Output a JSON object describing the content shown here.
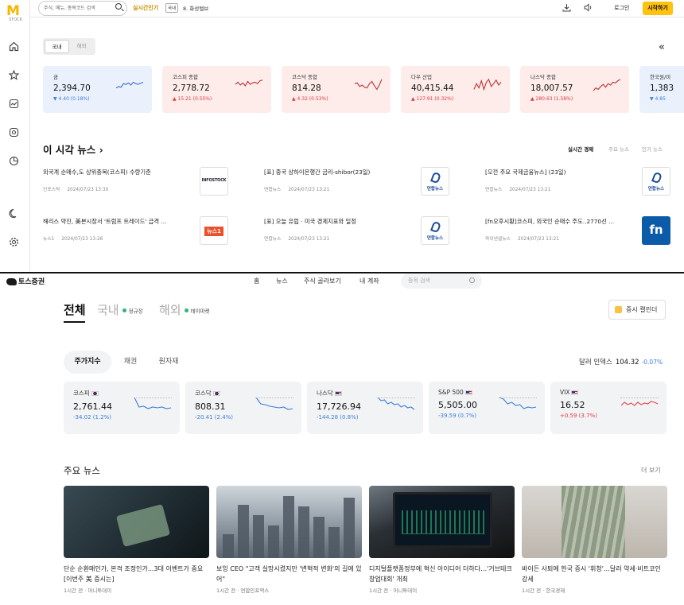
{
  "top": {
    "logo_text": "M",
    "logo_sub": "STOCK",
    "search_placeholder": "주식, 메뉴, 종목코드 검색",
    "realtime_label": "실시간인기",
    "realtime_badge": "국내",
    "realtime_item": "8. 화성밸브",
    "login": "로그인",
    "start": "시작하기",
    "market_tabs": [
      "국내",
      "해외"
    ],
    "cards": [
      {
        "name": "금",
        "value": "2,394.70",
        "change": "▼ 4.40 (0.18%)",
        "dir": "down"
      },
      {
        "name": "코스피 종합",
        "value": "2,778.72",
        "change": "▲ 15.21 (0.55%)",
        "dir": "up"
      },
      {
        "name": "코스닥 종합",
        "value": "814.28",
        "change": "▲ 4.32 (0.53%)",
        "dir": "up"
      },
      {
        "name": "다우 산업",
        "value": "40,415.44",
        "change": "▲ 127.91 (0.32%)",
        "dir": "up"
      },
      {
        "name": "나스닥 종합",
        "value": "18,007.57",
        "change": "▲ 280.63 (1.58%)",
        "dir": "up"
      },
      {
        "name": "한국원/미",
        "value": "1,383",
        "change": "▼ 4.85",
        "dir": "down"
      }
    ],
    "news_header": "이 시각 뉴스",
    "news_tabs": [
      "실시간 경제",
      "주요 뉴스",
      "인기 뉴스"
    ],
    "news": [
      {
        "title": "외국계 순매수,도 상위종목(코스피) 수량기준",
        "source": "인포스탁",
        "time": "2024/07/23 13:30",
        "thumb": "INFOSTOCK"
      },
      {
        "title": "[표] 중국 상하이은행간 금리-shibor(23일)",
        "source": "연합뉴스",
        "time": "2024/07/23 13:21",
        "thumb": "연합뉴스"
      },
      {
        "title": "[오전 주요 국제금융뉴스] (23일)",
        "source": "연합뉴스",
        "time": "2024/07/23 13:21",
        "thumb": "연합뉴스"
      },
      {
        "title": "해리스 약진, 美본시장서 '트럼프 트레이드' 급격 ...",
        "source": "뉴스1",
        "time": "2024/07/23 13:26",
        "thumb": "뉴스1"
      },
      {
        "title": "[표] 오늘 유럽 · 미국 경제지표와 일정",
        "source": "연합뉴스",
        "time": "2024/07/23 13:21",
        "thumb": "연합뉴스"
      },
      {
        "title": "[fn오후시황]코스피, 외국인 순매수 주도..2770선 ...",
        "source": "파이낸셜뉴스",
        "time": "2024/07/23 13:21",
        "thumb": "fn"
      }
    ]
  },
  "bot": {
    "logo": "토스증권",
    "nav": [
      "홈",
      "뉴스",
      "주식 골라보기",
      "내 계좌"
    ],
    "search_placeholder": "종목 검색",
    "main_tabs": [
      "전체",
      "국내",
      "해외"
    ],
    "market_status": [
      "정규장",
      "데이마켓"
    ],
    "calendar": "증시 캘린더",
    "filter_tabs": [
      "주가지수",
      "채권",
      "원자재"
    ],
    "dxy_label": "달러 인덱스",
    "dxy_value": "104.32",
    "dxy_change": "-0.07%",
    "cards": [
      {
        "name": "코스피",
        "flag": "kr",
        "value": "2,761.44",
        "change": "-34.02 (1.2%)",
        "dir": "down"
      },
      {
        "name": "코스닥",
        "flag": "kr",
        "value": "808.31",
        "change": "-20.41 (2.4%)",
        "dir": "down"
      },
      {
        "name": "나스닥",
        "flag": "us",
        "value": "17,726.94",
        "change": "-144.28 (0.8%)",
        "dir": "down"
      },
      {
        "name": "S&P 500",
        "flag": "us",
        "value": "5,505.00",
        "change": "-39.59 (0.7%)",
        "dir": "down"
      },
      {
        "name": "VIX",
        "flag": "us",
        "value": "16.52",
        "change": "+0.59 (3.7%)",
        "dir": "up"
      }
    ],
    "news_header": "주요 뉴스",
    "more": "더 보기",
    "news": [
      {
        "title": "단순 순환매인가, 본격 조정인가...3대 이벤트가 중요[이번주 美 증시는]",
        "meta": "1시간 전 · 머니투데이"
      },
      {
        "title": "보잉 CEO \"고객 실망시켰지만 '변혁적 변화'의 길에 있어\"",
        "meta": "1시간 전 · 연합인포맥스"
      },
      {
        "title": "디지털플랫폼정부에 혁신 아이디어 더하다…'거브테크 창업대회' 개최",
        "meta": "1시간 전 · 머니투데이"
      },
      {
        "title": "바이든 사퇴에 한국 증시 '휘청'…달러 약세·비트코인 강세",
        "meta": "1시간 전 · 한국경제"
      }
    ]
  },
  "colors": {
    "up": "#e0383e",
    "down": "#3b7dd8",
    "accent": "#ffc20e"
  }
}
